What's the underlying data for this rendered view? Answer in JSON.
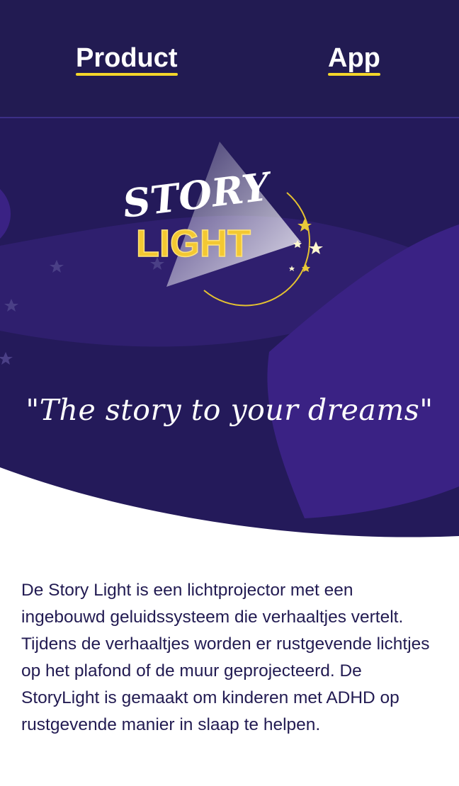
{
  "nav": {
    "items": [
      {
        "label": "Product"
      },
      {
        "label": "App"
      }
    ]
  },
  "hero": {
    "logo": {
      "line1": "STORY",
      "line2": "LIGHT"
    },
    "tagline": "\"The story to your dreams\""
  },
  "main": {
    "description": "De Story Light is een lichtprojector met een ingebouwd geluidssysteem die verhaaltjes vertelt. Tijdens de verhaaltjes worden er rustgevende lichtjes op het plafond of de muur geprojecteerd. De StoryLight is gemaakt om kinderen met ADHD op rustgevende manier in slaap te helpen."
  },
  "colors": {
    "navy": "#221b52",
    "purple": "#3a2284",
    "accent_yellow": "#f4d62a",
    "text": "#221b52"
  }
}
